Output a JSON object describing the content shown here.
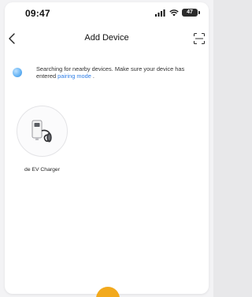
{
  "status_bar": {
    "time": "09:47",
    "battery_level": "47",
    "signal_icon": "signal-bars-icon",
    "wifi_icon": "wifi-icon"
  },
  "nav": {
    "title": "Add Device",
    "back_icon": "chevron-left-icon",
    "scan_icon": "scan-icon"
  },
  "search": {
    "text_main": "Searching for nearby devices. Make sure your device has entered",
    "pairing_link": "pairing mode",
    "text_end": " ."
  },
  "devices": [
    {
      "name": "de EV Charger",
      "icon": "ev-charger-icon"
    }
  ],
  "colors": {
    "accent": "#2f7ee6",
    "badge": "#f2a91d"
  }
}
